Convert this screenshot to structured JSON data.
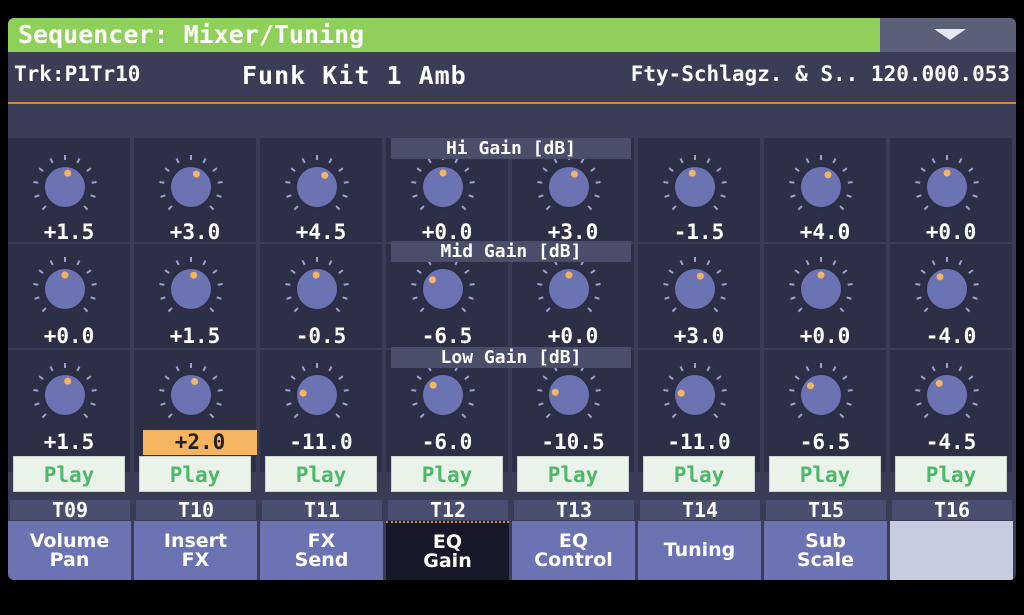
{
  "title": "Sequencer: Mixer/Tuning",
  "menu_icon": "dropdown-triangle-icon",
  "info": {
    "track": "Trk:P1Tr10",
    "kit": "Funk Kit 1 Amb",
    "fty": "Fty-Schlagz. & S.. 120.000.053"
  },
  "rows": [
    {
      "header": "Hi Gain [dB]",
      "values": [
        "+1.5",
        "+3.0",
        "+4.5",
        "+0.0",
        "+3.0",
        "-1.5",
        "+4.0",
        "+0.0"
      ]
    },
    {
      "header": "Mid Gain [dB]",
      "values": [
        "+0.0",
        "+1.5",
        "-0.5",
        "-6.5",
        "+0.0",
        "+3.0",
        "+0.0",
        "-4.0"
      ]
    },
    {
      "header": "Low Gain [dB]",
      "values": [
        "+1.5",
        "+2.0",
        "-11.0",
        "-6.0",
        "-10.5",
        "-11.0",
        "-6.5",
        "-4.5"
      ]
    }
  ],
  "selected": {
    "row": 2,
    "col": 1
  },
  "play_label": "Play",
  "tracks": [
    "T09",
    "T10",
    "T11",
    "T12",
    "T13",
    "T14",
    "T15",
    "T16"
  ],
  "tabs": [
    "Volume\nPan",
    "Insert\nFX",
    "FX\nSend",
    "EQ\nGain",
    "EQ\nControl",
    "Tuning",
    "Sub\nScale",
    ""
  ],
  "active_tab": 3,
  "colors": {
    "title_bg": "#8ed05a",
    "accent": "#d48a3a",
    "knob": "#6b73b3",
    "dot": "#f5b560",
    "play_text": "#4fb76a"
  }
}
